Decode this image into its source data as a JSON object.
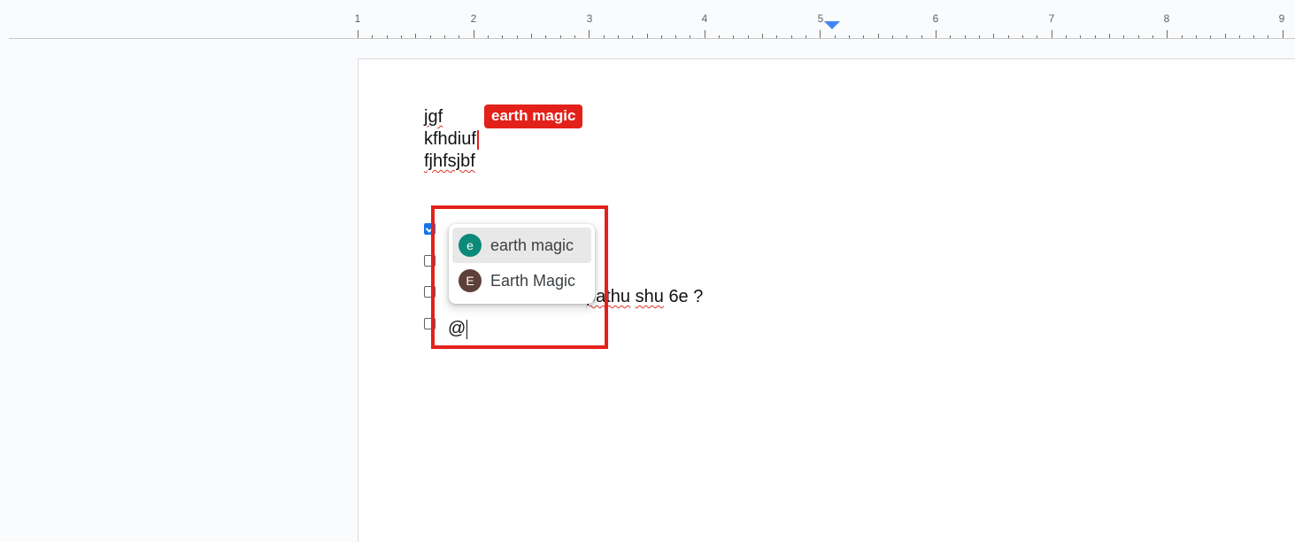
{
  "ruler": {
    "numbers": [
      "1",
      "2",
      "3",
      "4",
      "5",
      "6",
      "7",
      "8",
      "9"
    ]
  },
  "document": {
    "lines": [
      "jgf",
      "kfhdiuf",
      "fjhfsjbf"
    ],
    "task_text_partial": "pathu shu 6e ?",
    "task_text_parts": [
      "pathu",
      "shu",
      "6e ?"
    ],
    "input_line": "@"
  },
  "collaborator_cursor": {
    "name": "earth magic",
    "color": "#e3211b"
  },
  "checklist": {
    "items": [
      {
        "checked": true
      },
      {
        "checked": false
      },
      {
        "checked": false
      },
      {
        "checked": false
      }
    ]
  },
  "mention_menu": {
    "items": [
      {
        "initial": "e",
        "label": "earth magic",
        "avatar_color": "#0b8a7a"
      },
      {
        "initial": "E",
        "label": "Earth Magic",
        "avatar_color": "#5d4037"
      }
    ]
  },
  "colors": {
    "accent": "#1a73e8",
    "highlight": "#e3211b",
    "ruler_marker": "#4285f4"
  }
}
